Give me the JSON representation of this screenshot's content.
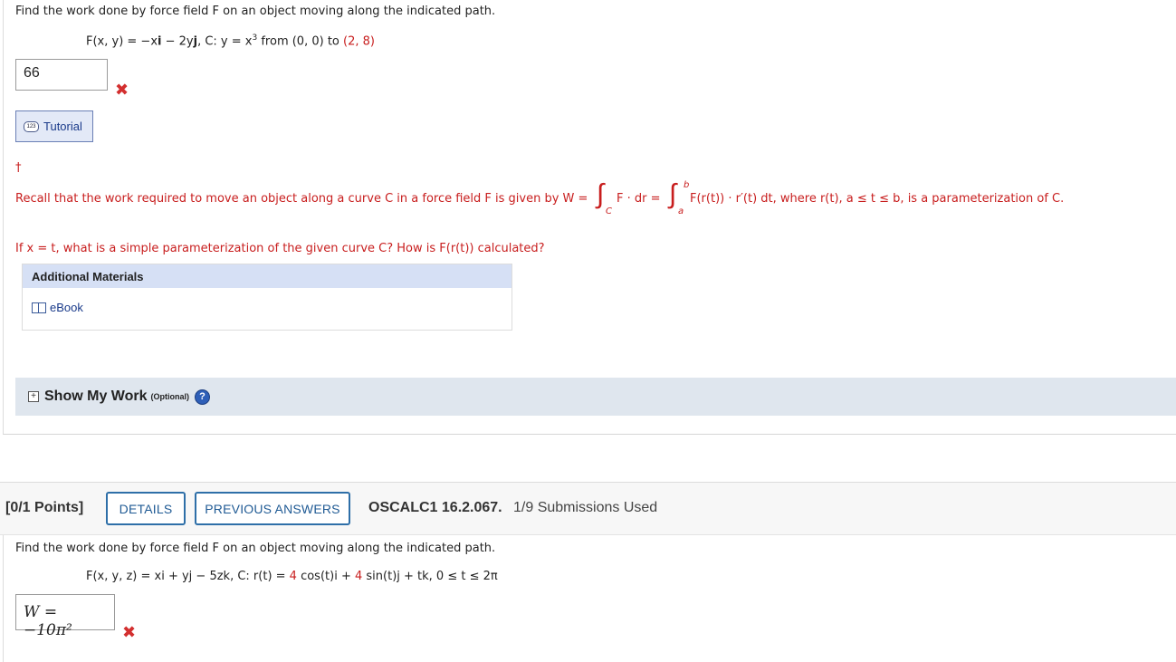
{
  "q1": {
    "prompt": "Find the work done by force field F on an object moving along the indicated path.",
    "formula": {
      "lhs": "F(x, y) = −x",
      "i1": "i",
      "mid": " − 2y",
      "j1": "j",
      "curve": ", C: y = x",
      "exp": "3",
      "from": " from (0, 0) to ",
      "endpoint": "(2, 8)"
    },
    "answer_value": "66",
    "tutorial_label": "Tutorial",
    "tutorial_icon_text": "123",
    "dagger": "†",
    "hint": {
      "recall": "Recall that the work required to move an object along a curve C in a force field F is given by W = ",
      "integral_symbol": "∫",
      "sub_c": "C",
      "sub_a": "a",
      "sup_b": "b",
      "f_dot_dr": "F · dr = ",
      "integrand": "F(r(t)) · r′(t) dt, where r(t), a ≤ t ≤ b, is a parameterization of C.",
      "if_line": "If x = t, what is a simple parameterization of the given curve C? How is F(r(t)) calculated?"
    },
    "additional_materials_label": "Additional Materials",
    "ebook_label": "eBook",
    "show_my_work_label": "Show My Work",
    "optional_label": "(Optional)",
    "help_symbol": "?"
  },
  "q2": {
    "points_label": "[0/1 Points]",
    "details_button": "DETAILS",
    "previous_answers_button": "PREVIOUS ANSWERS",
    "code": "OSCALC1 16.2.067.",
    "submissions": "1/9 Submissions Used",
    "prompt": "Find the work done by force field F on an object moving along the indicated path.",
    "formula": {
      "lhs": "F(x, y, z) = x",
      "rest": "i + yj − 5zk, C: r(t) = ",
      "four1": "4",
      "cos": " cos(t)i + ",
      "four2": "4",
      "tail": " sin(t)j + tk, 0 ≤ t ≤ 2π"
    },
    "answer_value": "W = −10π²"
  },
  "colors": {
    "hint_red": "#c81e1e",
    "error_x": "#d32f2f",
    "button_blue": "#1f5a94",
    "panel_header": "#d6e0f5",
    "show_work_bar": "#dfe6ee"
  },
  "icons": [
    "error-x-icon",
    "tutorial-icon",
    "ebook-icon",
    "expand-plus-icon",
    "help-icon"
  ]
}
